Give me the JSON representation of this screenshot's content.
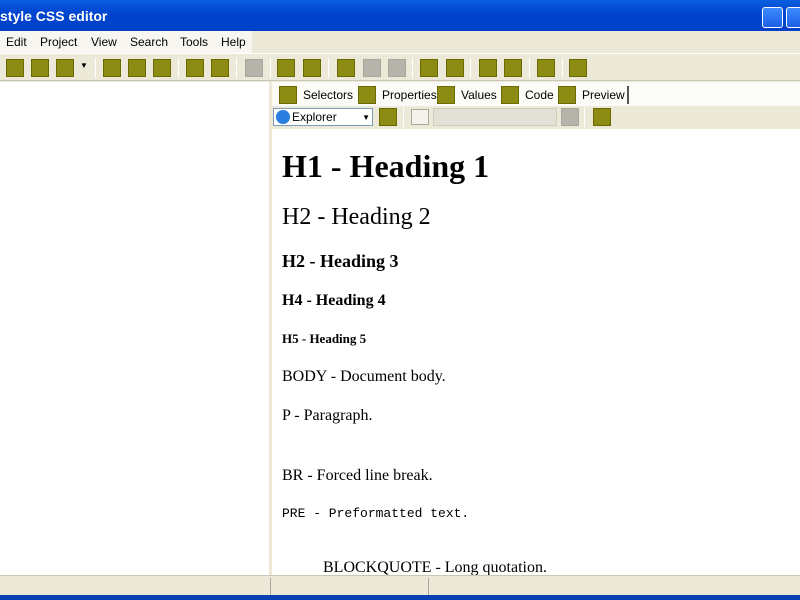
{
  "window": {
    "title": "style CSS editor"
  },
  "menu": [
    "Edit",
    "Project",
    "View",
    "Search",
    "Tools",
    "Help"
  ],
  "toolbar_icons": [
    "open-icon",
    "save-icon",
    "refresh-icon",
    "dropdown-arrow-icon",
    "add-icon",
    "remove-icon",
    "insert-icon",
    "move-up-icon",
    "move-down-icon",
    "disabled-icon",
    "list-icon",
    "tree-icon",
    "copy-icon",
    "paste-icon",
    "delete-icon",
    "monitor-icon",
    "find-icon",
    "binoculars-icon",
    "find-next-icon",
    "tools-icon",
    "help-icon"
  ],
  "tabs": [
    {
      "label": "Selectors"
    },
    {
      "label": "Properties"
    },
    {
      "label": "Values"
    },
    {
      "label": "Code"
    },
    {
      "label": "Preview"
    }
  ],
  "preview_toolbar": {
    "browser": "Explorer"
  },
  "preview": {
    "h1": "H1 - Heading 1",
    "h2": "H2 - Heading 2",
    "h3": "H2 - Heading 3",
    "h4": "H4 - Heading 4",
    "h5": "H5 - Heading 5",
    "body": "BODY - Document body.",
    "p": "P - Paragraph.",
    "br": "BR - Forced line break.",
    "pre": "PRE - Preformatted text.",
    "blockquote": "BLOCKQUOTE - Long quotation."
  },
  "colors": {
    "titlebar": "#0045d0",
    "icon_bg": "#8c8c14"
  }
}
